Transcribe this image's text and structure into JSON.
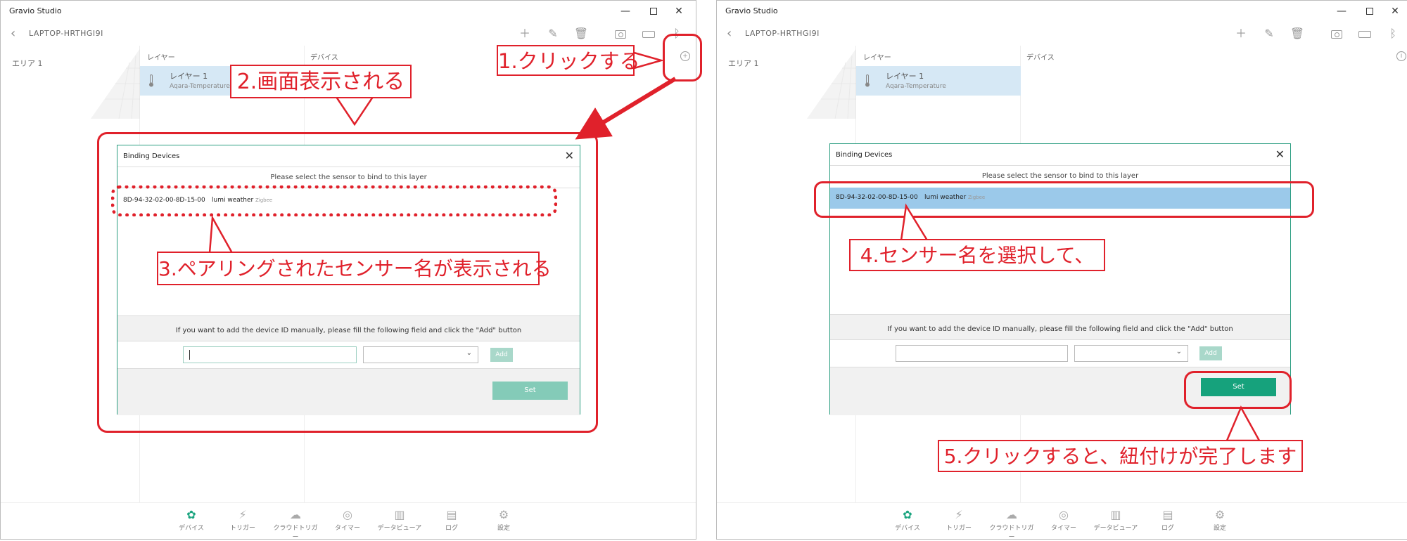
{
  "app": {
    "title": "Gravio Studio",
    "device_name": "LAPTOP-HRTHGI9I",
    "columns": {
      "layer": "レイヤー",
      "device": "デバイス"
    },
    "area_label": "エリア 1",
    "layer_card": {
      "name": "レイヤー 1",
      "type": "Aqara-Temperature"
    },
    "toolbar_icons": [
      "add-icon",
      "edit-icon",
      "delete-icon",
      "camera-icon",
      "keyboard-icon",
      "bluetooth-icon"
    ],
    "accent_color": "#16a27c",
    "highlight_color": "#e0212b"
  },
  "nav": [
    {
      "label": "デバイス",
      "icon": "device-icon",
      "active": true
    },
    {
      "label": "トリガー",
      "icon": "trigger-icon"
    },
    {
      "label": "クラウドトリガー",
      "icon": "cloud-trigger-icon"
    },
    {
      "label": "タイマー",
      "icon": "timer-icon"
    },
    {
      "label": "データビューア",
      "icon": "data-viewer-icon"
    },
    {
      "label": "ログ",
      "icon": "log-icon"
    },
    {
      "label": "設定",
      "icon": "settings-icon"
    }
  ],
  "dialog": {
    "title": "Binding Devices",
    "prompt": "Please select the sensor to bind to this layer",
    "sensor": {
      "id": "8D-94-32-02-00-8D-15-00",
      "name": "lumi weather",
      "protocol": "Zigbee"
    },
    "instructions": "If you want to add the device ID manually, please fill the following field and click the \"Add\" button",
    "add_label": "Add",
    "set_label": "Set"
  },
  "callouts": {
    "c1": "1.クリックする",
    "c2": "2.画面表示される",
    "c3": "3.ペアリングされたセンサー名が表示される",
    "c4": "4.センサー名を選択して、",
    "c5": "5.クリックすると、紐付けが完了します"
  }
}
